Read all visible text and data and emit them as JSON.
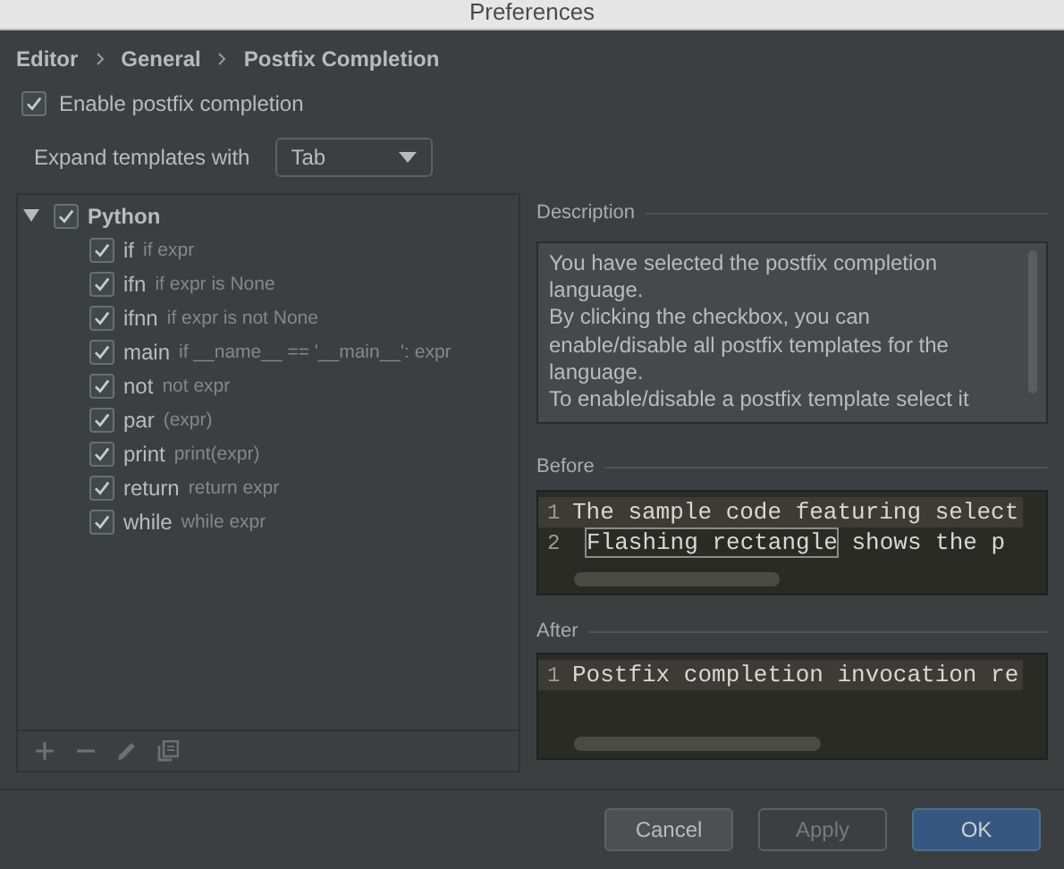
{
  "window": {
    "title": "Preferences"
  },
  "breadcrumb": [
    "Editor",
    "General",
    "Postfix Completion"
  ],
  "enable_option": {
    "label": "Enable postfix completion",
    "checked": true
  },
  "expand_with": {
    "label": "Expand templates with",
    "value": "Tab"
  },
  "tree": [
    {
      "name": "Python",
      "checked": true,
      "expanded": true,
      "children": [
        {
          "name": "if",
          "hint": "if expr",
          "checked": true
        },
        {
          "name": "ifn",
          "hint": "if expr is None",
          "checked": true
        },
        {
          "name": "ifnn",
          "hint": "if expr is not None",
          "checked": true
        },
        {
          "name": "main",
          "hint": "if __name__ == '__main__': expr",
          "checked": true
        },
        {
          "name": "not",
          "hint": "not expr",
          "checked": true
        },
        {
          "name": "par",
          "hint": "(expr)",
          "checked": true
        },
        {
          "name": "print",
          "hint": "print(expr)",
          "checked": true
        },
        {
          "name": "return",
          "hint": "return expr",
          "checked": true
        },
        {
          "name": "while",
          "hint": "while expr",
          "checked": true
        }
      ]
    }
  ],
  "tree_toolbar": [
    {
      "kind": "add"
    },
    {
      "kind": "remove"
    },
    {
      "kind": "edit"
    },
    {
      "kind": "copy"
    }
  ],
  "description": {
    "title": "Description",
    "lines": [
      "You have selected the postfix completion language.",
      "By clicking the checkbox, you can enable/disable all postfix templates for the language.",
      "To enable/disable a postfix template select it"
    ]
  },
  "before": {
    "title": "Before",
    "lines": [
      {
        "number": "1",
        "current": true,
        "segments": [
          {
            "text": "The sample code featuring select",
            "boxed": false
          }
        ]
      },
      {
        "number": "2",
        "current": false,
        "segments": [
          {
            "text": "Flashing rectangle",
            "boxed": true
          },
          {
            "text": " shows the p",
            "boxed": false
          }
        ]
      }
    ]
  },
  "after": {
    "title": "After",
    "lines": [
      {
        "number": "1",
        "current": true,
        "segments": [
          {
            "text": "Postfix completion invocation re",
            "boxed": false
          }
        ]
      }
    ]
  },
  "buttons": [
    {
      "label": "Cancel",
      "kind": "normal",
      "disabled": false
    },
    {
      "label": "Apply",
      "kind": "normal",
      "disabled": true
    },
    {
      "label": "OK",
      "kind": "primary",
      "disabled": false
    }
  ]
}
